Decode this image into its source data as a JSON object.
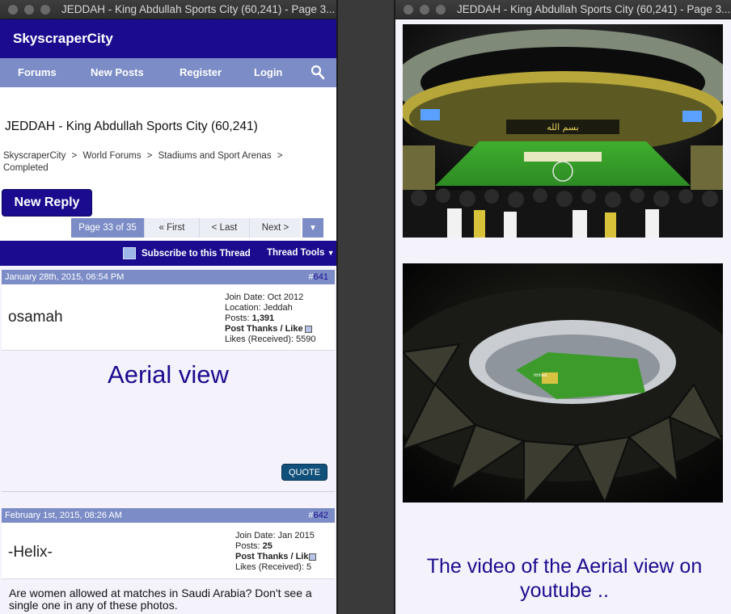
{
  "left_window": {
    "title": "JEDDAH - King Abdullah Sports City (60,241) - Page 3...",
    "site": {
      "brand": "SkyscraperCity"
    },
    "nav": {
      "items": [
        "Forums",
        "New Posts",
        "Register",
        "Login"
      ]
    },
    "thread": {
      "title": "JEDDAH - King Abdullah Sports City (60,241)",
      "breadcrumb": [
        "SkyscraperCity",
        ">",
        "World Forums",
        ">",
        "Stadiums and Sport Arenas",
        ">",
        "Completed"
      ]
    },
    "new_reply_label": "New Reply",
    "pagination": {
      "current": "Page 33 of 35",
      "first": "« First",
      "last": "< Last",
      "next": "Next >"
    },
    "thread_bar": {
      "subscribe": "Subscribe to this Thread",
      "tools": "Thread Tools"
    },
    "posts": [
      {
        "date": "January 28th, 2015, 06:54 PM",
        "hash": "#",
        "number": "641",
        "username": "osamah",
        "join_date": "Join Date: Oct 2012",
        "location": "Location: Jeddah",
        "posts_label": "Posts:",
        "posts_count": "1,391",
        "thanks_label": "Post Thanks / Like",
        "likes": "Likes (Received): 5590",
        "content_title": "Aerial view",
        "quote_label": "QUOTE"
      },
      {
        "date": "February 1st, 2015, 08:26 AM",
        "hash": "#",
        "number": "642",
        "username": "-Helix-",
        "join_date": "Join Date: Jan 2015",
        "posts_label": "Posts:",
        "posts_count": "25",
        "thanks_label": "Post Thanks / Like",
        "likes": "Likes (Received): 5",
        "text": "Are women allowed at matches in Saudi Arabia? Don't see a single one in any of these photos."
      }
    ]
  },
  "right_window": {
    "title": "JEDDAH - King Abdullah Sports City (60,241) - Page 3...",
    "caption": "The video of the Aerial view on youtube .."
  },
  "icons": [
    "search-icon",
    "subscribe-icon",
    "dropdown-arrow-icon",
    "post-thanks-icon"
  ],
  "colors": {
    "brand": "#1b0c8f",
    "nav": "#7b8cc6",
    "quote": "#11507a"
  }
}
